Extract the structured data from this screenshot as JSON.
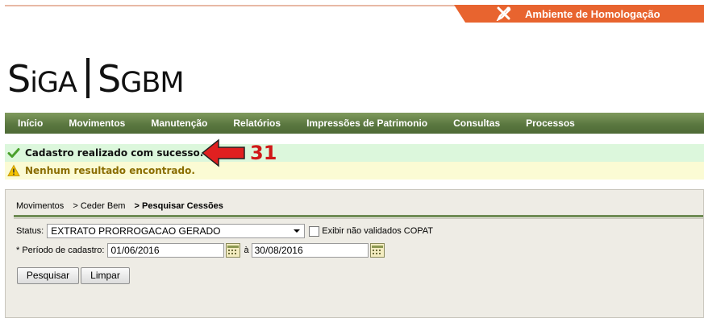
{
  "environment": {
    "label": "Ambiente de Homologação",
    "icon": "wrench-icon",
    "color": "#e8642f"
  },
  "logo": {
    "part1_big": "S",
    "part1_small": "iGA",
    "part2_big": "S",
    "part2_small": "GBM"
  },
  "nav": {
    "items": [
      {
        "label": "Início"
      },
      {
        "label": "Movimentos"
      },
      {
        "label": "Manutenção"
      },
      {
        "label": "Relatórios"
      },
      {
        "label": "Impressões de Patrimonio"
      },
      {
        "label": "Consultas"
      },
      {
        "label": "Processos"
      }
    ],
    "color": "#5b7840"
  },
  "messages": {
    "success": {
      "text": "Cadastro realizado com sucesso.",
      "icon": "check-icon",
      "color": "#dcf7dc"
    },
    "warning": {
      "text": "Nenhum resultado encontrado.",
      "icon": "warning-icon",
      "color": "#fbfbd4"
    }
  },
  "annotation": {
    "number": "31",
    "icon": "red-arrow-icon",
    "color": "#d01818"
  },
  "breadcrumb": {
    "items": [
      "Movimentos",
      "> Ceder Bem",
      "> Pesquisar Cessões"
    ]
  },
  "form": {
    "status_label": "Status:",
    "status_value": "EXTRATO PRORROGACAO GERADO",
    "checkbox_label": "Exibir não validados COPAT",
    "checkbox_checked": false,
    "periodo_label": "* Período de cadastro:",
    "date_from": "01/06/2016",
    "date_separator": "à",
    "date_to": "30/08/2016",
    "search_button": "Pesquisar",
    "clear_button": "Limpar"
  }
}
